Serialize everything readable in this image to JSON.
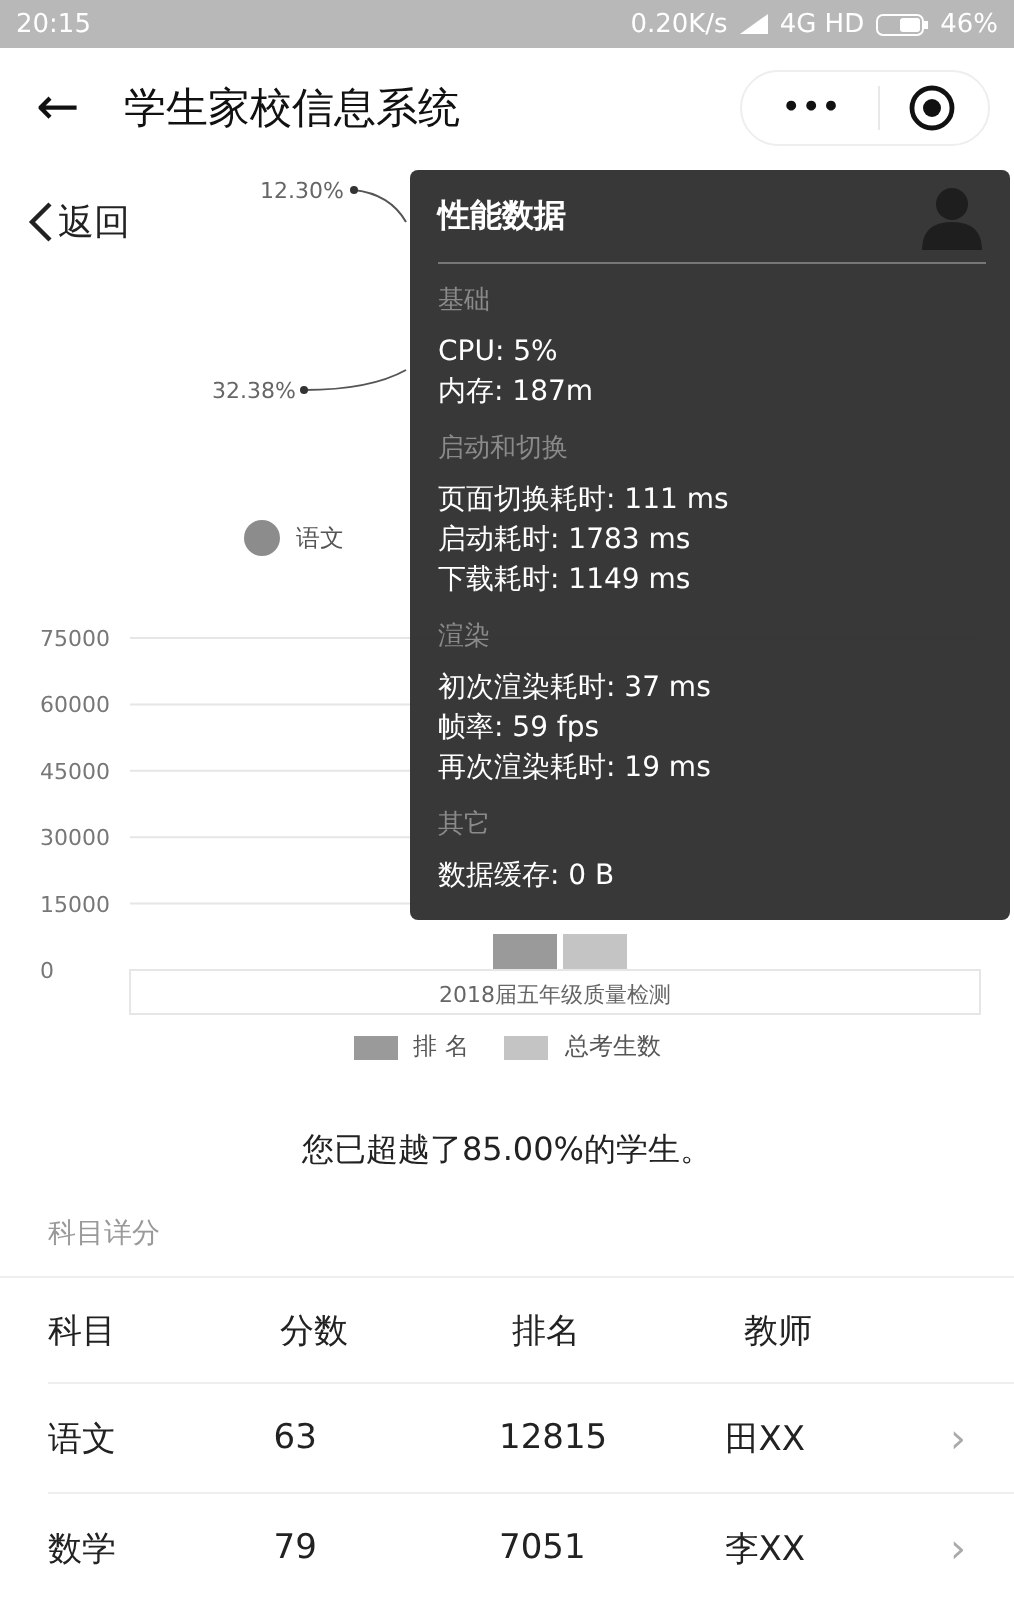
{
  "status_bar": {
    "time": "20:15",
    "speed": "0.20K/s",
    "network": "4G HD",
    "battery": "46%"
  },
  "nav": {
    "back_arrow": "←",
    "title": "学生家校信息系统",
    "more": "•••"
  },
  "back_link": {
    "label": "返回"
  },
  "pie_chart": {
    "value_labels": [
      "12.30%",
      "32.38%"
    ],
    "legend": [
      {
        "label": "语文"
      }
    ]
  },
  "bar_chart": {
    "y_axis_labels": [
      "75000",
      "60000",
      "45000",
      "30000",
      "15000",
      "0"
    ],
    "category": "2018届五年级质量检测",
    "legend": [
      {
        "label": "排 名",
        "color": "#9a9a9a"
      },
      {
        "label": "总考生数",
        "color": "#c4c4c4"
      }
    ]
  },
  "perf_panel": {
    "title": "性能数据",
    "sections": [
      {
        "heading": "基础",
        "lines": [
          "CPU: 5%",
          "内存: 187m"
        ]
      },
      {
        "heading": "启动和切换",
        "lines": [
          "页面切换耗时: 111 ms",
          "启动耗时: 1783 ms",
          "下载耗时: 1149 ms"
        ]
      },
      {
        "heading": "渲染",
        "lines": [
          "初次渲染耗时: 37 ms",
          "帧率: 59 fps",
          "再次渲染耗时: 19 ms"
        ]
      },
      {
        "heading": "其它",
        "lines": [
          "数据缓存: 0 B"
        ]
      }
    ]
  },
  "summary": "您已超越了85.00%的学生。",
  "section_title": "科目详分",
  "table": {
    "columns": [
      "科目",
      "分数",
      "排名",
      "教师"
    ],
    "rows": [
      {
        "cells": [
          "语文",
          "63",
          "12815",
          "田XX"
        ],
        "chevron": "›"
      },
      {
        "cells": [
          "数学",
          "79",
          "7051",
          "李XX"
        ],
        "chevron": "›"
      }
    ]
  }
}
